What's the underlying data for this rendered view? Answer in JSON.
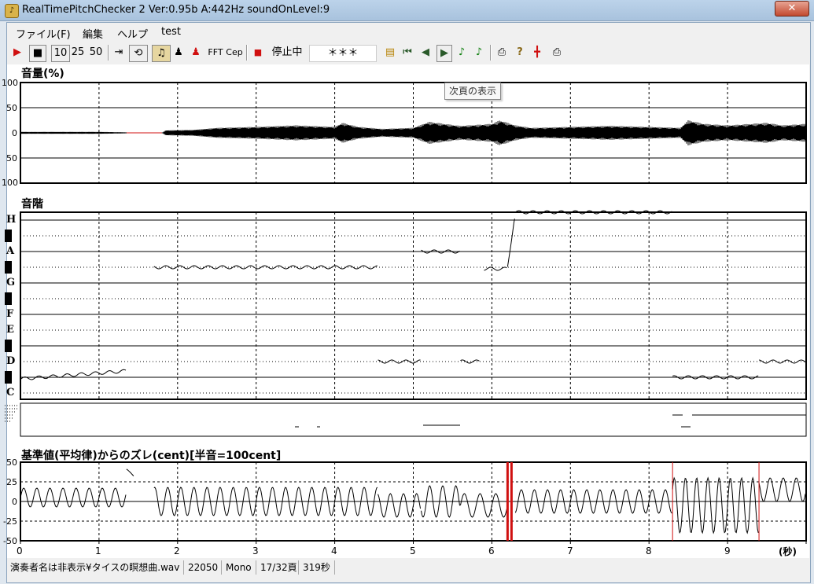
{
  "window": {
    "title": "RealTimePitchChecker 2    Ver:0.95b        A:442Hz    soundOnLevel:9",
    "close_label": "x",
    "app_icon": "tuning-fork-icon"
  },
  "menu": [
    "ファイル(F)",
    "編集",
    "ヘルプ",
    "test"
  ],
  "toolbar": {
    "opt10": "10",
    "opt25": "25",
    "opt50": "50",
    "fft": "FFT",
    "cep": "Cep",
    "status": "停止中",
    "display": "＊＊＊"
  },
  "tooltip": "次頁の表示",
  "volume_panel": {
    "title": "音量(%)",
    "ticks": [
      "100",
      "50",
      "0",
      "50",
      "100"
    ]
  },
  "scale_panel": {
    "title": "音階",
    "notes": [
      "H",
      "A",
      "G",
      "F",
      "E",
      "D",
      "C"
    ]
  },
  "cent_panel": {
    "title": "基準値(平均律)からのズレ(cent)[半音=100cent]",
    "ticks": [
      "50",
      "25",
      "0",
      "-25",
      "-50"
    ]
  },
  "x_axis": {
    "ticks": [
      "0",
      "1",
      "2",
      "3",
      "4",
      "5",
      "6",
      "7",
      "8",
      "9"
    ],
    "unit": "(秒)"
  },
  "status_bar": {
    "file": "演奏者名は非表示¥タイスの瞑想曲.wav",
    "rate": "22050",
    "channels": "Mono",
    "page": "17/32頁",
    "duration": "319秒"
  },
  "colors": {
    "play": "#d01010",
    "marker": "#d01010",
    "grid": "#000000"
  },
  "chart_data": [
    {
      "type": "area",
      "title": "音量(%)",
      "xlabel": "(秒)",
      "ylim": [
        -100,
        100
      ],
      "x_range": [
        0,
        10
      ],
      "envelope": [
        {
          "x": 0.0,
          "amp": 2
        },
        {
          "x": 0.5,
          "amp": 2
        },
        {
          "x": 1.0,
          "amp": 2
        },
        {
          "x": 1.35,
          "amp": 1
        },
        {
          "x": 1.45,
          "amp": 0
        },
        {
          "x": 1.8,
          "amp": 0
        },
        {
          "x": 1.85,
          "amp": 5
        },
        {
          "x": 2.2,
          "amp": 6
        },
        {
          "x": 2.5,
          "amp": 10
        },
        {
          "x": 3.0,
          "amp": 12
        },
        {
          "x": 3.5,
          "amp": 15
        },
        {
          "x": 4.0,
          "amp": 12
        },
        {
          "x": 4.1,
          "amp": 20
        },
        {
          "x": 4.3,
          "amp": 12
        },
        {
          "x": 4.6,
          "amp": 8
        },
        {
          "x": 5.0,
          "amp": 10
        },
        {
          "x": 5.2,
          "amp": 22
        },
        {
          "x": 5.6,
          "amp": 14
        },
        {
          "x": 6.0,
          "amp": 18
        },
        {
          "x": 6.1,
          "amp": 25
        },
        {
          "x": 6.3,
          "amp": 15
        },
        {
          "x": 6.5,
          "amp": 10
        },
        {
          "x": 7.0,
          "amp": 12
        },
        {
          "x": 7.5,
          "amp": 14
        },
        {
          "x": 8.0,
          "amp": 12
        },
        {
          "x": 8.4,
          "amp": 10
        },
        {
          "x": 8.5,
          "amp": 25
        },
        {
          "x": 8.7,
          "amp": 18
        },
        {
          "x": 9.0,
          "amp": 15
        },
        {
          "x": 9.5,
          "amp": 20
        },
        {
          "x": 9.7,
          "amp": 15
        },
        {
          "x": 10.0,
          "amp": 18
        }
      ],
      "silent_segment": [
        1.35,
        1.8
      ]
    },
    {
      "type": "line",
      "title": "音階",
      "categories": [
        "C",
        "D",
        "E",
        "F",
        "G",
        "A",
        "H"
      ],
      "segments": [
        {
          "x": [
            0.0,
            1.35
          ],
          "level": 0.45,
          "end_level": 0.7
        },
        {
          "x": [
            1.7,
            4.55
          ],
          "level": 4.5
        },
        {
          "x": [
            4.55,
            5.1
          ],
          "level": 1.0
        },
        {
          "x": [
            5.1,
            5.6
          ],
          "level": 5.0
        },
        {
          "x": [
            5.6,
            5.85
          ],
          "level": 1.0
        },
        {
          "x": [
            5.9,
            6.2
          ],
          "level": 4.45
        },
        {
          "x": [
            6.2,
            6.3
          ],
          "level": 4.5,
          "end_level": 6.3
        },
        {
          "x": [
            6.3,
            8.3
          ],
          "level": 6.5
        },
        {
          "x": [
            8.3,
            9.4
          ],
          "level": 0.5
        },
        {
          "x": [
            9.4,
            10.0
          ],
          "level": 1.0
        }
      ]
    },
    {
      "type": "line",
      "title": "基準値(平均律)からのズレ(cent)[半音=100cent]",
      "xlabel": "(秒)",
      "ylim": [
        -50,
        50
      ],
      "x_range": [
        0,
        10
      ],
      "markers": [
        6.2,
        6.25,
        8.3,
        9.4
      ],
      "oscillation": [
        {
          "x": [
            0.0,
            1.35
          ],
          "center": 5,
          "amp": 12,
          "freq": 6
        },
        {
          "x": [
            1.35,
            1.45
          ],
          "center": 25,
          "amp": 20,
          "freq": 1
        },
        {
          "x": [
            1.7,
            4.55
          ],
          "center": 0,
          "amp": 18,
          "freq": 6
        },
        {
          "x": [
            4.55,
            5.1
          ],
          "center": -5,
          "amp": 15,
          "freq": 6
        },
        {
          "x": [
            5.1,
            5.6
          ],
          "center": 0,
          "amp": 20,
          "freq": 6
        },
        {
          "x": [
            5.6,
            6.2
          ],
          "center": -5,
          "amp": 15,
          "freq": 5
        },
        {
          "x": [
            6.3,
            8.3
          ],
          "center": 0,
          "amp": 15,
          "freq": 6
        },
        {
          "x": [
            8.3,
            9.4
          ],
          "center": -5,
          "amp": 35,
          "freq": 7
        },
        {
          "x": [
            9.4,
            10.0
          ],
          "center": 15,
          "amp": 15,
          "freq": 6
        }
      ]
    }
  ]
}
